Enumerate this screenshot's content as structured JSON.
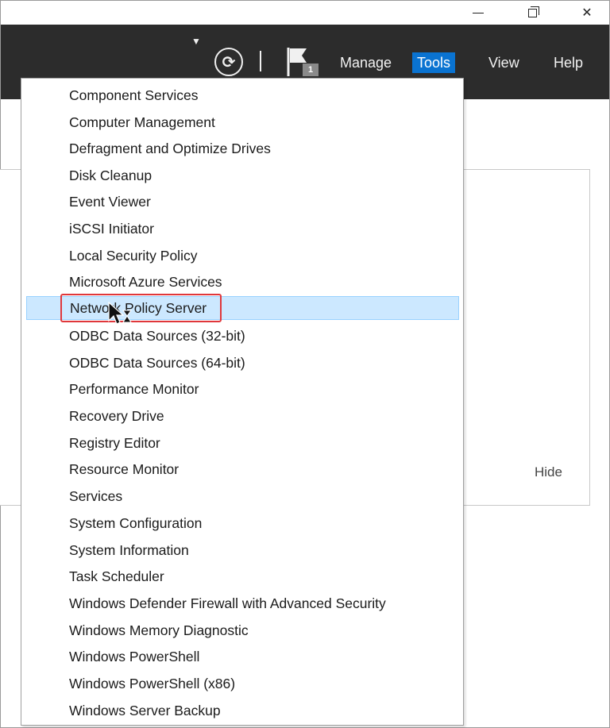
{
  "window": {
    "minimize_icon": "minimize-icon",
    "restore_icon": "restore-icon",
    "close_icon": "close-icon",
    "close_glyph": "✕"
  },
  "header": {
    "dropdown_icon": "caret-down-icon",
    "refresh_icon": "refresh-icon",
    "flag_icon": "notification-flag-icon",
    "notification_count": "1",
    "menus": [
      "Manage",
      "Tools",
      "View",
      "Help"
    ],
    "active_menu": "Tools",
    "active_color": "#0a73d1"
  },
  "panel": {
    "hide_label": "Hide"
  },
  "tools_menu": {
    "highlighted": "Network Policy Server",
    "highlight_color": "#cce8ff",
    "callout_color": "#e0373b",
    "items": [
      "Component Services",
      "Computer Management",
      "Defragment and Optimize Drives",
      "Disk Cleanup",
      "Event Viewer",
      "iSCSI Initiator",
      "Local Security Policy",
      "Microsoft Azure Services",
      "Network Policy Server",
      "ODBC Data Sources (32-bit)",
      "ODBC Data Sources (64-bit)",
      "Performance Monitor",
      "Recovery Drive",
      "Registry Editor",
      "Resource Monitor",
      "Services",
      "System Configuration",
      "System Information",
      "Task Scheduler",
      "Windows Defender Firewall with Advanced Security",
      "Windows Memory Diagnostic",
      "Windows PowerShell",
      "Windows PowerShell (x86)",
      "Windows Server Backup"
    ]
  }
}
